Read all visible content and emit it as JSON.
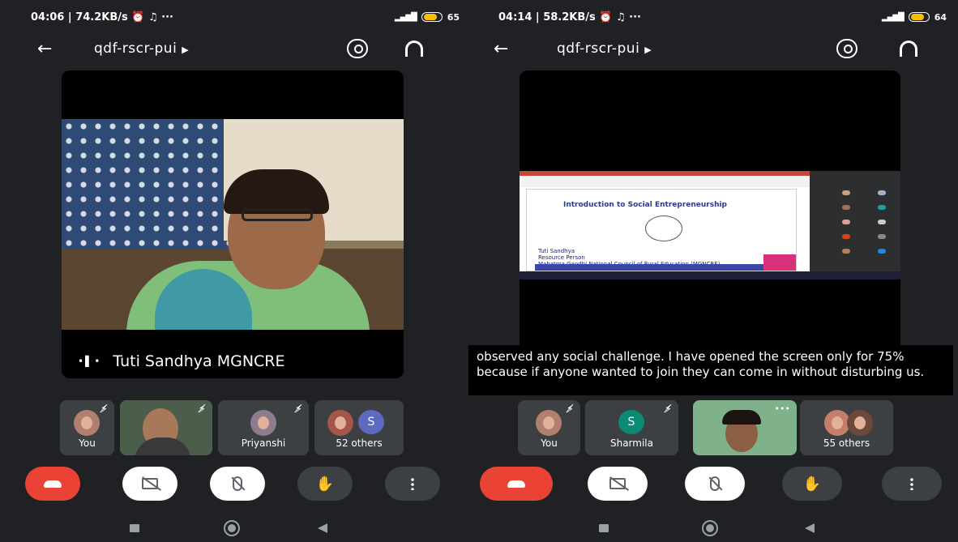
{
  "left": {
    "status": {
      "time": "04:06",
      "speed": "74.2KB/s",
      "battery": "65"
    },
    "meeting_code": "qdf-rscr-pui",
    "speaker_name": "Tuti Sandhya MGNCRE",
    "participants": [
      "You",
      "Priyanshi",
      "52 others"
    ],
    "avatar_letter": "S"
  },
  "right": {
    "status": {
      "time": "04:14",
      "speed": "58.2KB/s",
      "battery": "64"
    },
    "meeting_code": "qdf-rscr-pui",
    "shared_slide": {
      "title": "Introduction to Social Entrepreneurship",
      "presenter": "Tuti Sandhya",
      "role": "Resource Person",
      "org": "Mahatma Gandhi National Council of Rural Education (MGNCRE)"
    },
    "caption": "observed any social challenge. I have opened the screen only for 75% because if anyone wanted to join they can come in without disturbing us.",
    "participants": [
      "You",
      "Sharmila",
      "55 others"
    ],
    "avatar_letter": "S"
  },
  "colors": {
    "end_call": "#ea4335",
    "background": "#202124",
    "tile": "#3c4043",
    "avatar_blue": "#5c6bc0",
    "avatar_teal": "#0b8a74"
  }
}
